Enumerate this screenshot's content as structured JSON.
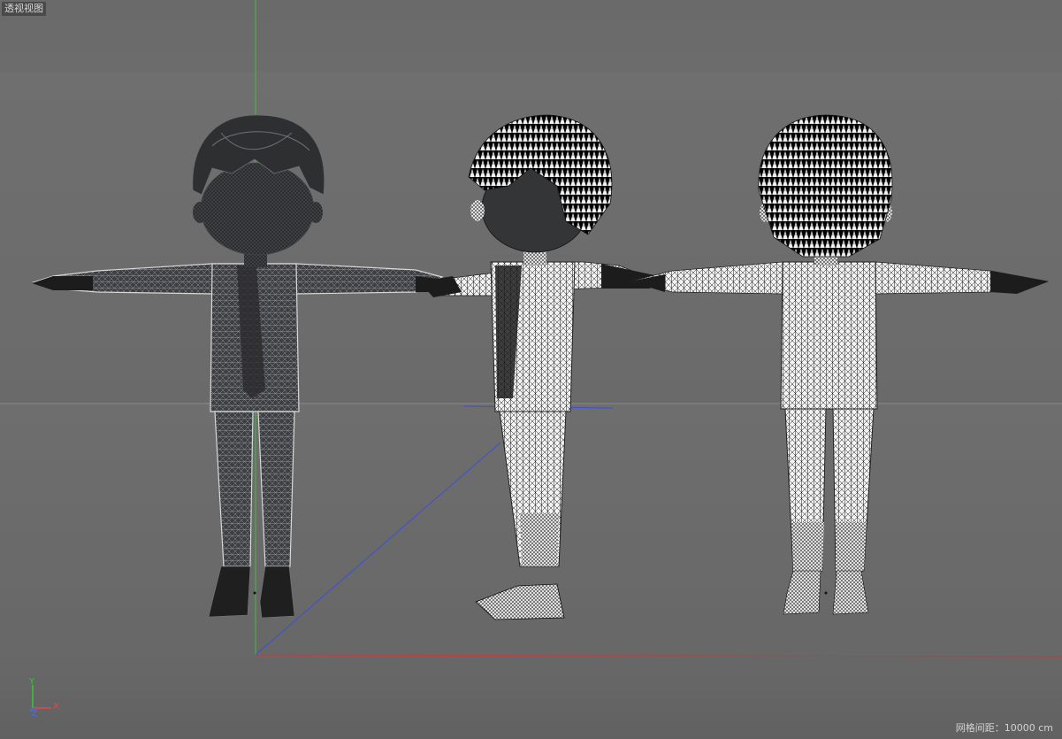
{
  "viewport": {
    "name_label": "透视视图",
    "grid_spacing_label": "网格间距：10000 cm"
  },
  "axes": {
    "x_label": "X",
    "y_label": "Y",
    "z_label": "Z",
    "x_color": "#e04a4a",
    "y_color": "#39c639",
    "z_color": "#4a6fe0"
  },
  "models": [
    {
      "view": "front",
      "shading": "dark-wireframe"
    },
    {
      "view": "side",
      "shading": "light-wireframe"
    },
    {
      "view": "back",
      "shading": "light-wireframe"
    }
  ]
}
